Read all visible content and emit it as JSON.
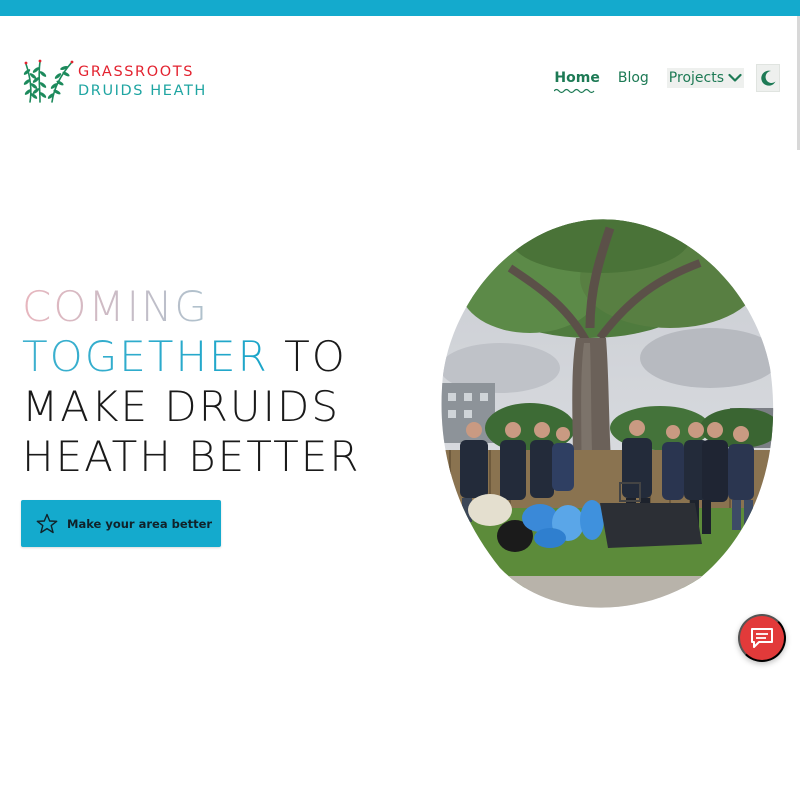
{
  "brand": {
    "line1": "GRASSROOTS",
    "line2": "DRUIDS HEATH",
    "logo_icon": "reed-grass-icon",
    "colors": {
      "red": "#e3222f",
      "teal": "#1fa5a2",
      "green": "#1d7a55"
    }
  },
  "nav": {
    "items": [
      {
        "label": "Home",
        "active": true
      },
      {
        "label": "Blog",
        "active": false
      },
      {
        "label": "Projects",
        "active": false,
        "has_dropdown": true
      }
    ],
    "theme_toggle_icon": "moon-icon"
  },
  "hero": {
    "title_part1": "COMING",
    "title_part2": "TOGETHER",
    "title_part3": " TO",
    "title_line3": "MAKE DRUIDS",
    "title_line4": "HEATH BETTER",
    "cta_label": "Make your area better",
    "cta_icon": "star-outline-icon",
    "accent_color": "#14aacd"
  },
  "photo": {
    "subject": "volunteers-litter-pick-photo"
  },
  "chat": {
    "icon": "chat-bubble-icon",
    "color": "#e23a3a"
  }
}
